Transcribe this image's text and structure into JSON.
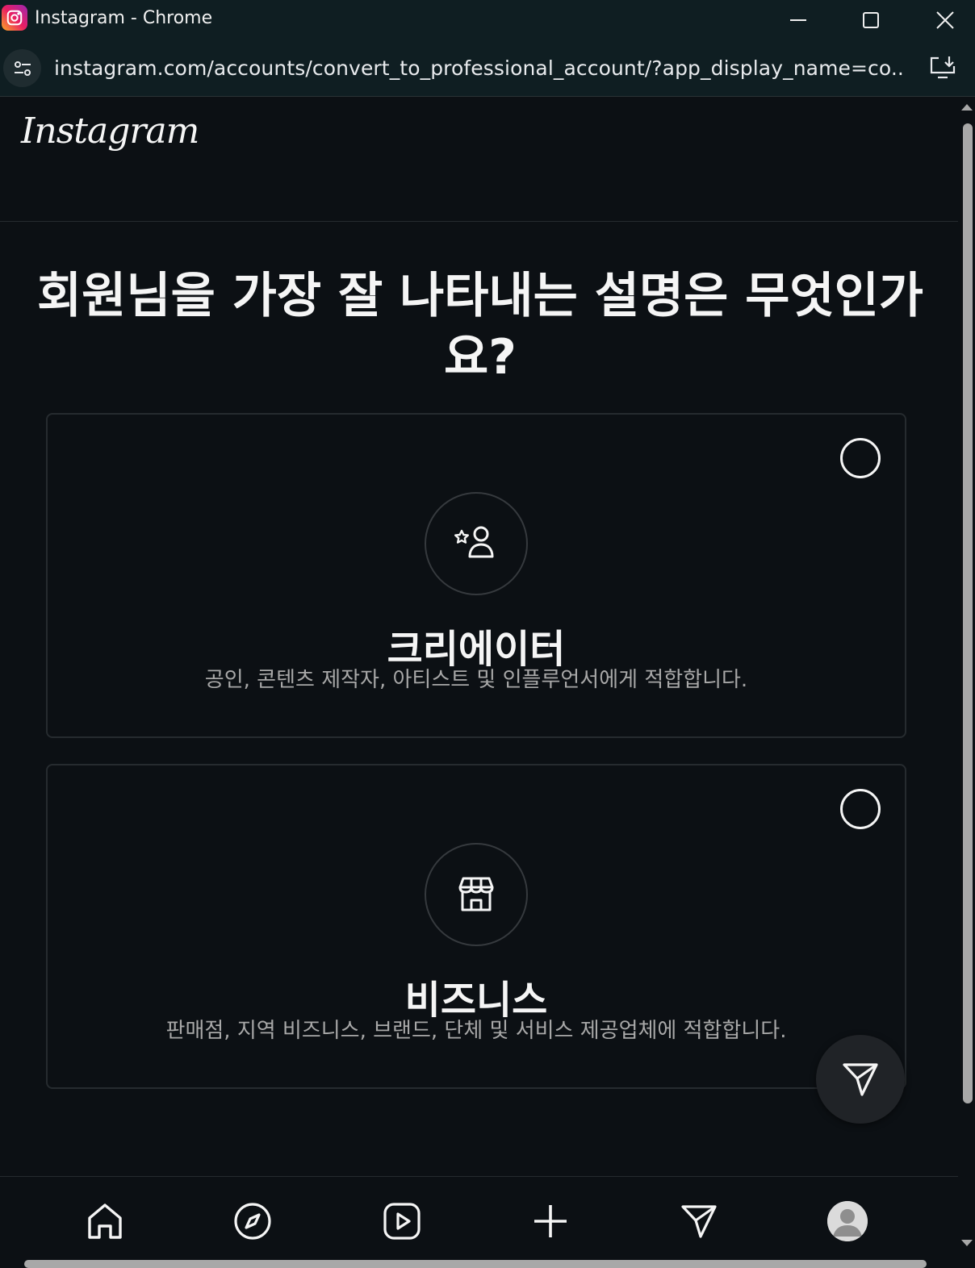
{
  "window": {
    "title": "Instagram - Chrome"
  },
  "address_bar": {
    "url": "instagram.com/accounts/convert_to_professional_account/?app_display_name=co..."
  },
  "header": {
    "logo_text": "Instagram"
  },
  "main": {
    "question": "회원님을 가장 잘 나타내는 설명은 무엇인가요?",
    "options": [
      {
        "title": "크리에이터",
        "description": "공인, 콘텐츠 제작자, 아티스트 및 인플루언서에게 적합합니다.",
        "icon": "creator-icon",
        "selected": false
      },
      {
        "title": "비즈니스",
        "description": "판매점, 지역 비즈니스, 브랜드, 단체 및 서비스 제공업체에 적합합니다.",
        "icon": "shop-icon",
        "selected": false
      }
    ]
  },
  "bottom_nav": {
    "items": [
      "home-icon",
      "explore-icon",
      "reels-icon",
      "create-icon",
      "direct-icon",
      "profile-avatar"
    ]
  },
  "colors": {
    "background": "#0c1014",
    "titlebar": "#0f1e22",
    "text": "#f5f5f5",
    "secondary_text": "#a8a8a8",
    "border": "#262b2f"
  }
}
